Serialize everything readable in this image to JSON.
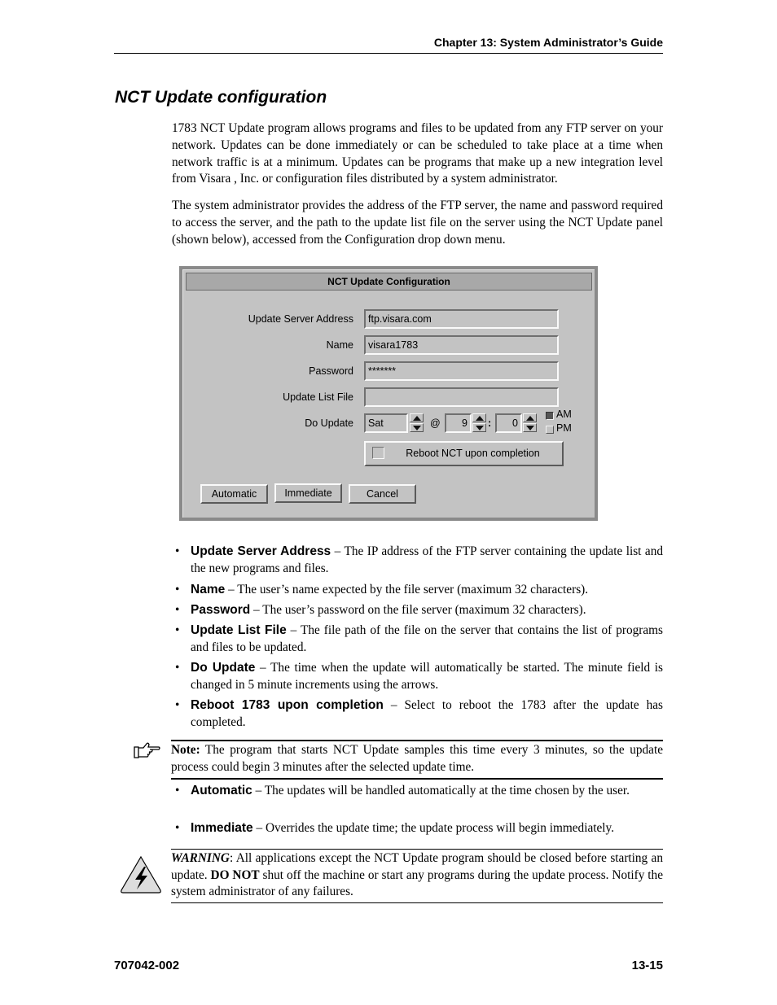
{
  "header": {
    "chapter": "Chapter 13: System Administrator’s Guide"
  },
  "section_title": "NCT Update configuration",
  "paragraphs": [
    "1783 NCT Update program allows programs and files to be updated from any FTP server on your network. Updates can be done immediately or can be scheduled to take place at a time when network traffic is at a minimum. Updates can be programs that make up a new integration level from Visara , Inc. or configuration files distributed by a system administrator.",
    "The system administrator provides the address of the FTP server, the name and password required to access the server, and the path to the update list file on the server using the NCT Update panel (shown below), accessed from the Configuration drop down menu."
  ],
  "dialog": {
    "title": "NCT Update Configuration",
    "fields": {
      "server_label": "Update Server Address",
      "server_value": "ftp.visara.com",
      "name_label": "Name",
      "name_value": "visara1783",
      "password_label": "Password",
      "password_value": "*******",
      "list_label": "Update List File",
      "list_value": ""
    },
    "do_update": {
      "label": "Do Update",
      "day": "Sat",
      "at": "@",
      "hour": "9",
      "colon": ":",
      "minute": "0",
      "am_label": "AM",
      "pm_label": "PM",
      "selected": "AM"
    },
    "reboot_label": "Reboot NCT upon completion",
    "reboot_checked": false,
    "buttons": {
      "automatic": "Automatic",
      "immediate": "Immediate",
      "cancel": "Cancel"
    }
  },
  "bullets1": [
    {
      "term": "Update Server Address",
      "desc": " – The IP address of the FTP server containing the update list and the new programs and files."
    },
    {
      "term": "Name",
      "desc": " – The user’s name expected by the file server (maximum 32 characters)."
    },
    {
      "term": "Password",
      "desc": " – The user’s password on the file server (maximum 32 characters)."
    },
    {
      "term": "Update List File",
      "desc": " – The file path of the file on the server that contains the list of programs and files to be updated."
    },
    {
      "term": "Do Update",
      "desc": " – The time when the update will automatically be started. The minute field is changed in 5 minute increments using the arrows."
    },
    {
      "term": "Reboot 1783 upon completion",
      "desc": " – Select to reboot the 1783 after the update has completed."
    }
  ],
  "note": {
    "label": "Note:",
    "text": " The program that starts NCT Update samples this time every 3 minutes, so the update process could begin 3 minutes after the selected update time."
  },
  "bullets2": [
    {
      "term": "Automatic",
      "desc": " – The updates will be handled automatically at the time chosen by the user."
    },
    {
      "term": "Immediate",
      "desc": " – Overrides the update time; the update process will begin immediately."
    }
  ],
  "warning": {
    "label": "WARNING",
    "text1": ": All applications except the NCT Update program should be closed before starting an update. ",
    "bold": "DO NOT",
    "text2": " shut off the machine or start any programs during the update process. Notify the system administrator of any failures."
  },
  "footer": {
    "doc_number": "707042-002",
    "page": "13-15"
  },
  "bullet_char": "•"
}
